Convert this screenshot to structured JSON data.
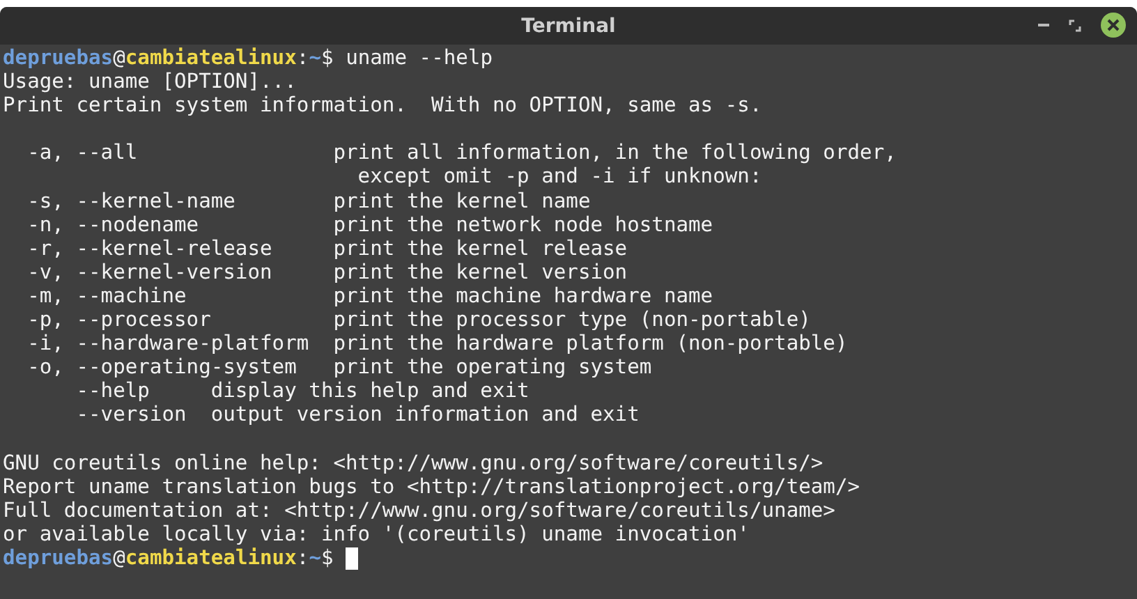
{
  "window": {
    "title": "Terminal"
  },
  "prompt": {
    "user": "depruebas",
    "at": "@",
    "host": "cambiatealinux",
    "separator": ":",
    "path": "~",
    "symbol": "$"
  },
  "command": "uname --help",
  "output_blocks": [
    [
      "Usage: uname [OPTION]...",
      "Print certain system information.  With no OPTION, same as -s."
    ],
    [
      "  -a, --all                print all information, in the following order,",
      "                             except omit -p and -i if unknown:",
      "  -s, --kernel-name        print the kernel name",
      "  -n, --nodename           print the network node hostname",
      "  -r, --kernel-release     print the kernel release",
      "  -v, --kernel-version     print the kernel version",
      "  -m, --machine            print the machine hardware name",
      "  -p, --processor          print the processor type (non-portable)",
      "  -i, --hardware-platform  print the hardware platform (non-portable)",
      "  -o, --operating-system   print the operating system",
      "      --help     display this help and exit",
      "      --version  output version information and exit"
    ],
    [
      "GNU coreutils online help: <http://www.gnu.org/software/coreutils/>",
      "Report uname translation bugs to <http://translationproject.org/team/>",
      "Full documentation at: <http://www.gnu.org/software/coreutils/uname>",
      "or available locally via: info '(coreutils) uname invocation'"
    ]
  ],
  "final_prompt": {
    "user": "depruebas",
    "at": "@",
    "host": "cambiatealinux",
    "separator": ":",
    "path": "~",
    "symbol": "$",
    "cursor": true
  }
}
